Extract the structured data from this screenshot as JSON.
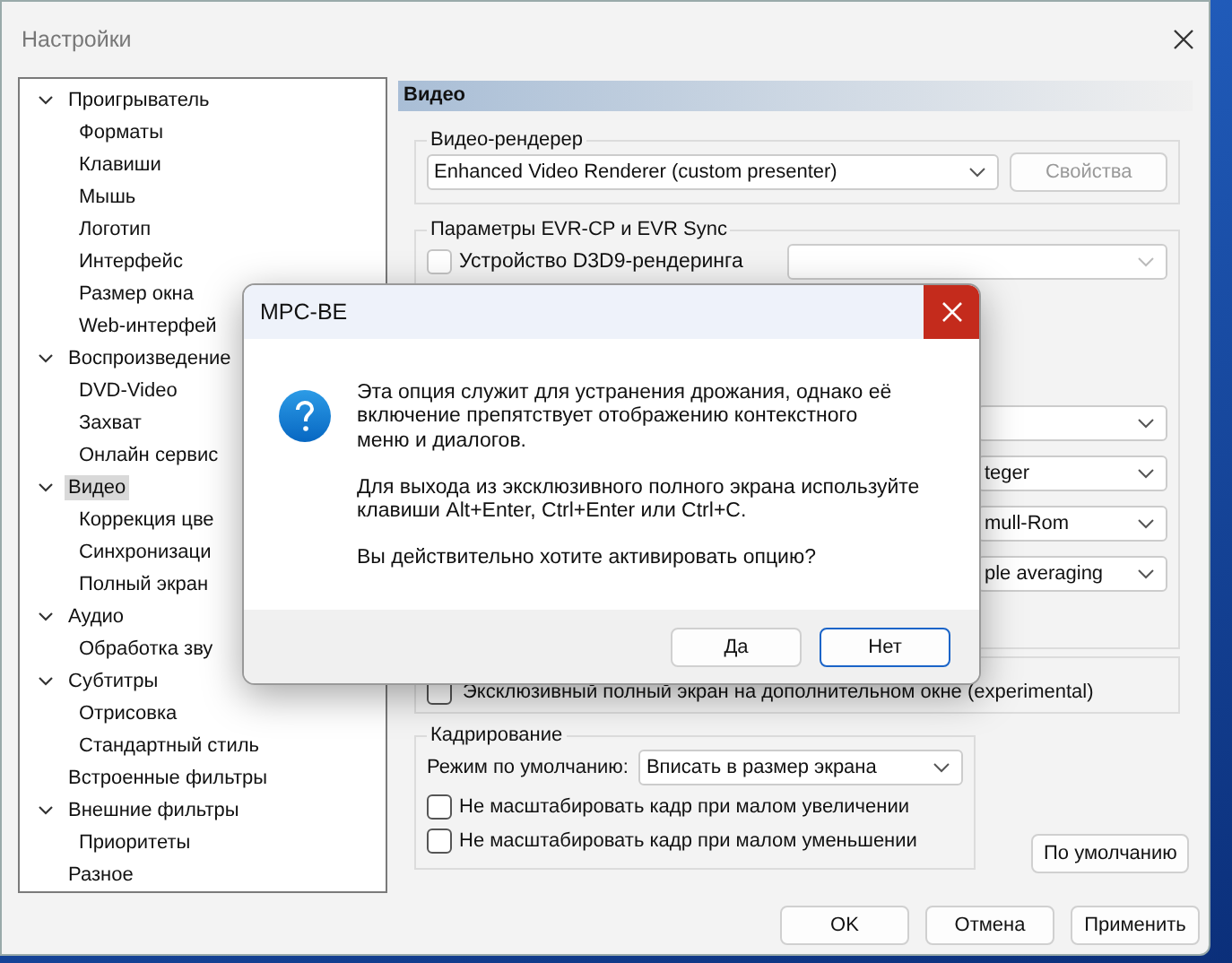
{
  "window": {
    "title": "Настройки"
  },
  "tree": [
    {
      "label": "Проигрыватель",
      "expanded": true,
      "selected": false,
      "children": [
        {
          "label": "Форматы",
          "selected": false
        },
        {
          "label": "Клавиши",
          "selected": false
        },
        {
          "label": "Мышь",
          "selected": false
        },
        {
          "label": "Логотип",
          "selected": false
        },
        {
          "label": "Интерфейс",
          "selected": false
        },
        {
          "label": "Размер окна",
          "selected": false
        },
        {
          "label": "Web-интерфей",
          "selected": false
        }
      ]
    },
    {
      "label": "Воспроизведение",
      "expanded": true,
      "selected": false,
      "children": [
        {
          "label": "DVD-Video",
          "selected": false
        },
        {
          "label": "Захват",
          "selected": false
        },
        {
          "label": "Онлайн сервис",
          "selected": false
        }
      ]
    },
    {
      "label": "Видео",
      "expanded": true,
      "selected": true,
      "children": [
        {
          "label": "Коррекция цве",
          "selected": false
        },
        {
          "label": "Синхронизаци",
          "selected": false
        },
        {
          "label": "Полный экран",
          "selected": false
        }
      ]
    },
    {
      "label": "Аудио",
      "expanded": true,
      "selected": false,
      "children": [
        {
          "label": "Обработка зву",
          "selected": false
        }
      ]
    },
    {
      "label": "Субтитры",
      "expanded": true,
      "selected": false,
      "children": [
        {
          "label": "Отрисовка",
          "selected": false
        },
        {
          "label": "Стандартный стиль",
          "selected": false
        }
      ]
    },
    {
      "label": "Встроенные фильтры",
      "selected": false
    },
    {
      "label": "Внешние фильтры",
      "expanded": true,
      "selected": false,
      "children": [
        {
          "label": "Приоритеты",
          "selected": false
        }
      ]
    },
    {
      "label": "Разное",
      "selected": false
    }
  ],
  "page": {
    "title": "Видео",
    "renderer_group": {
      "title": "Видео-рендерер",
      "renderer": "Enhanced Video Renderer (custom presenter)",
      "properties_button": {
        "label": "Свойства",
        "disabled": true
      }
    },
    "evr_group": {
      "title": "Параметры EVR-CP и EVR Sync",
      "d3d9": {
        "label": "Устройство D3D9-рендеринга",
        "checked": false,
        "disabled": true
      },
      "dropdowns": [
        "teger",
        "mull-Rom",
        "ple averaging"
      ]
    },
    "exclusive": {
      "label": "Эксклюзивный полный экран на дополнительном окне (experimental)",
      "checked": false
    },
    "framing": {
      "title": "Кадрирование",
      "mode_label": "Режим по умолчанию:",
      "mode": "Вписать в размер экрана",
      "options": [
        {
          "label": "Не масштабировать кадр при малом увеличении",
          "checked": false
        },
        {
          "label": "Не масштабировать кадр при малом уменьшении",
          "checked": false
        }
      ]
    },
    "defaults_button": "По умолчанию"
  },
  "buttons": [
    "OK",
    "Отмена",
    "Применить"
  ],
  "dialog": {
    "title": "MPC-BE",
    "paragraphs": [
      "Эта опция служит для устранения дрожания, однако её\nвключение препятствует отображению контекстного\nменю и диалогов.",
      "Для выхода из эксклюзивного полного экрана используйте\nклавиши Alt+Enter, Ctrl+Enter или Ctrl+C.",
      "Вы действительно хотите активировать опцию?"
    ],
    "buttons": [
      {
        "label": "Да",
        "default": false
      },
      {
        "label": "Нет",
        "default": true
      }
    ]
  }
}
